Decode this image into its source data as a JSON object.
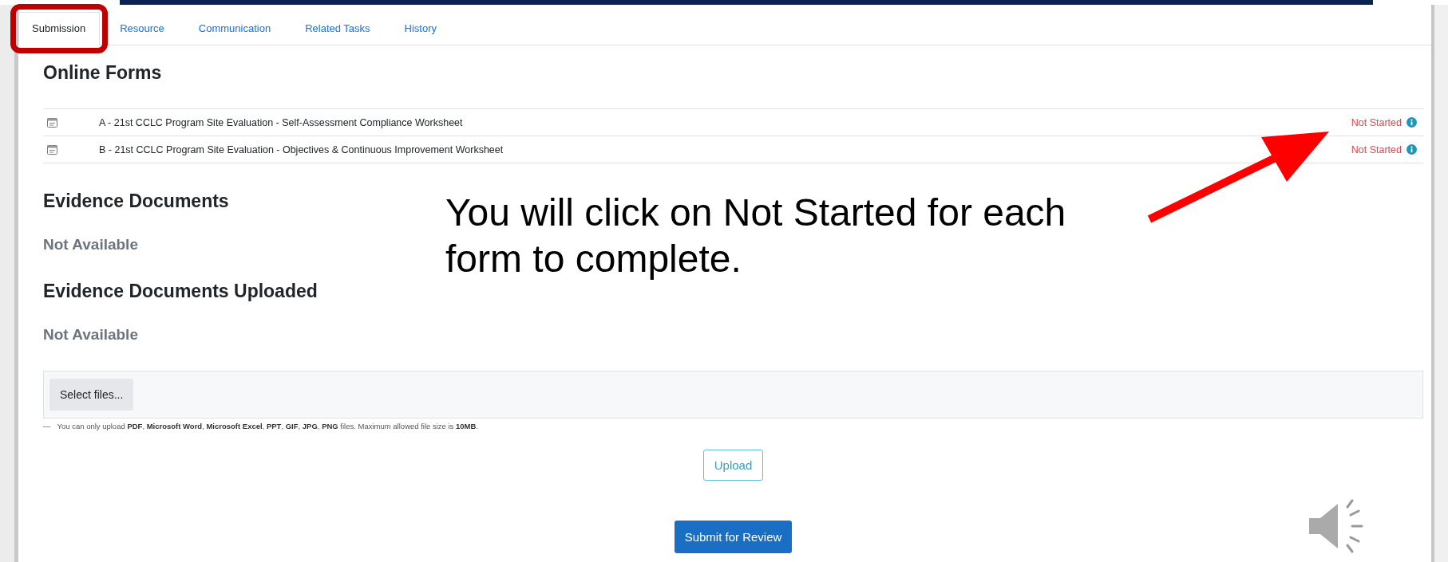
{
  "tabs": [
    {
      "label": "Submission",
      "selected": true,
      "highlighted": true
    },
    {
      "label": "Resource",
      "selected": false,
      "highlighted": false
    },
    {
      "label": "Communication",
      "selected": false,
      "highlighted": false
    },
    {
      "label": "Related Tasks",
      "selected": false,
      "highlighted": false
    },
    {
      "label": "History",
      "selected": false,
      "highlighted": false
    }
  ],
  "online_forms": {
    "title": "Online Forms",
    "forms": [
      {
        "name": "A - 21st CCLC Program Site Evaluation - Self-Assessment Compliance Worksheet",
        "status": "Not Started"
      },
      {
        "name": "B - 21st CCLC Program Site Evaluation - Objectives & Continuous Improvement Worksheet",
        "status": "Not Started"
      }
    ]
  },
  "sections": [
    {
      "title": "Evidence Documents",
      "text": "Not Available"
    },
    {
      "title": "Evidence Documents Uploaded",
      "text": "Not Available"
    }
  ],
  "upload": {
    "select_button": "Select files...",
    "note_dash": "—",
    "note": "You can only upload **PDF**, **Microsoft Word**, **Microsoft Excel**, **PPT**, **GIF**, **JPG**, **PNG** files. Maximum allowed file size is **10MB**.",
    "upload_button": "Upload"
  },
  "submit_button": "Submit for Review",
  "callout": {
    "text": "You will click on Not Started for each form to complete."
  }
}
